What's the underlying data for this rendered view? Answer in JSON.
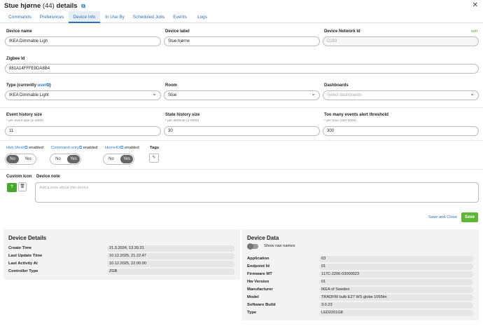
{
  "header": {
    "title": "Stue hjørne",
    "count": "(44)",
    "suffix": "details"
  },
  "tabs": [
    "Commands",
    "Preferences",
    "Device Info",
    "In Use By",
    "Scheduled Jobs",
    "Events",
    "Logs"
  ],
  "form": {
    "device_name_label": "Device name",
    "device_name": "IKEA Dimmable Ligh",
    "device_label_label": "Device label",
    "device_label": "Stue hjørne",
    "network_id_label": "Device Network Id",
    "network_id": "D283",
    "edit": "edit",
    "zigbee_label": "Zigbee Id",
    "zigbee_id": "881A14FFFE8DA8B4",
    "type_label_pre": "Type (currently ",
    "type_label_link": "user",
    "type_label_post": ")",
    "type_value": "IKEA Dimmable Light",
    "room_label": "Room",
    "room_value": "Stue",
    "dashboards_label": "Dashboards",
    "dashboards_placeholder": "Select dashboards",
    "event_history_label": "Event history size",
    "event_history_sub": "* per event type (1-2000)",
    "event_history": "11",
    "state_history_label": "State history size",
    "state_history_sub": "* per attribute (1-2000)",
    "state_history": "30",
    "too_many_label": "Too many events alert threshold",
    "too_many_sub": "* per hour (100-2000)",
    "too_many": "300",
    "hubmesh_link": "Hub Mesh",
    "command_retry_link": "Command retry",
    "homekit_link": "HomeKit",
    "enabled": "enabled",
    "no": "No",
    "yes": "Yes",
    "tags_label": "Tags",
    "custom_icon_label": "Custom Icon",
    "icon_button": "?",
    "device_note_label": "Device note",
    "device_note_placeholder": "Add a note about this device",
    "save_close": "Save and Close",
    "save": "Save"
  },
  "details": {
    "title": "Device Details",
    "rows": [
      {
        "label": "Create Time",
        "value": "21.3.2024, 13.39.31"
      },
      {
        "label": "Last Update Time",
        "value": "10.12.2025, 21.22.47"
      },
      {
        "label": "Last Activity At",
        "value": "10.12.2025, 22.00.00"
      },
      {
        "label": "Controller Type",
        "value": "ZGB"
      }
    ]
  },
  "data": {
    "title": "Device Data",
    "raw_label": "Show raw names",
    "rows": [
      {
        "label": "Application",
        "value": "03"
      },
      {
        "label": "Endpoint Id",
        "value": "01"
      },
      {
        "label": "Firmware MT",
        "value": "117C-2206-03000023"
      },
      {
        "label": "Hw Version",
        "value": "01"
      },
      {
        "label": "Manufacturer",
        "value": "IKEA of Sweden"
      },
      {
        "label": "Model",
        "value": "TRADFRI bulb E27 WS globe 1055lm"
      },
      {
        "label": "Software Build",
        "value": "3.0.23"
      },
      {
        "label": "Type",
        "value": "LED2201G8"
      }
    ]
  }
}
